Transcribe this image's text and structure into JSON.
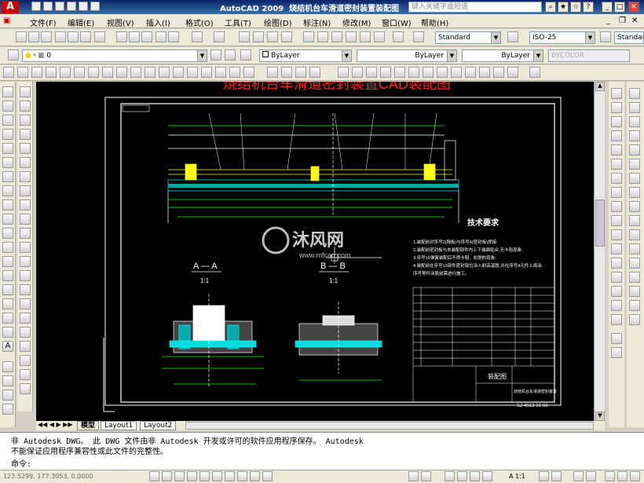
{
  "titlebar": {
    "app_title": "AutoCAD 2009",
    "doc_title": "烧结机台车滑道密封装置装配图",
    "search_placeholder": "键入关键字或短语"
  },
  "menu": {
    "items": [
      "文件(F)",
      "编辑(E)",
      "视图(V)",
      "插入(I)",
      "格式(O)",
      "工具(T)",
      "绘图(D)",
      "标注(N)",
      "修改(M)",
      "窗口(W)",
      "帮助(H)"
    ]
  },
  "styles": {
    "text_style": "Standard",
    "dim_style": "ISO-25",
    "table_style": "Standar"
  },
  "layers": {
    "current_layer": "0",
    "color": "ByLayer",
    "linetype": "ByLayer",
    "lineweight": "ByLayer",
    "plot_style": "BYCOLOR"
  },
  "drawing": {
    "title": "烧结机台车滑道密封装置CAD装配图",
    "section_aa": "A — A",
    "section_bb": "B — B",
    "scale_aa": "1:1",
    "scale_bb": "1:1",
    "tech_title": "技术要求",
    "watermark_name": "沐风网",
    "watermark_url": "www.mfcad.com",
    "notes": [
      "1.装配前对序号2(隔板)与序号4(密封板)焊接;",
      "2.装配前密封板与本装配部件内上下端面贴合,无卡阻现象;",
      "3.序号19弹簧装配后不得卡阻、松弛的现象;",
      "4.装配前在序号13部件密封部位涂入耐高温胶,并在序号4元件上面涂;",
      "  序号零件涂胶前需进行施工。"
    ],
    "title_block_name": "装配图",
    "title_block_desc": "烧结机台车滑道密封装置",
    "drawing_number": "SJ-4913-21-00"
  },
  "tabs": {
    "model": "模型",
    "layout1": "Layout1",
    "layout2": "Layout2"
  },
  "command": {
    "line1": "非 Autodesk DWG。  此 DWG 文件由非 Autodesk 开发或许可的软件应用程序保存。  Autodesk",
    "line2": "不能保证应用程序兼容性或此文件的完整性。",
    "prompt": "命令:"
  },
  "status": {
    "coords": "123.5299, 177.3053, 0.0000",
    "scale": "A 1:1"
  }
}
